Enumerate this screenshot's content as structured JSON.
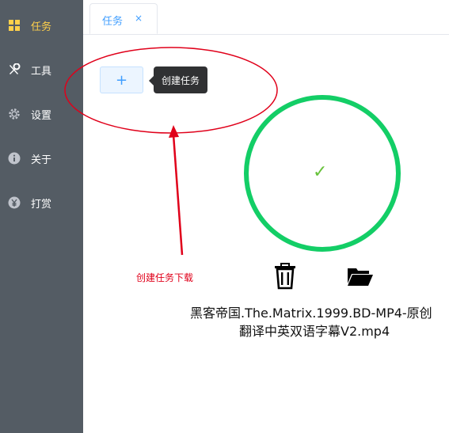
{
  "sidebar": {
    "items": [
      {
        "label": "任务",
        "icon": "grid-icon",
        "active": true
      },
      {
        "label": "工具",
        "icon": "tools-icon",
        "active": false
      },
      {
        "label": "设置",
        "icon": "gear-icon",
        "active": false
      },
      {
        "label": "关于",
        "icon": "info-icon",
        "active": false
      },
      {
        "label": "打赏",
        "icon": "yen-icon",
        "active": false
      }
    ],
    "background": "#545c64",
    "active_color": "#ffd04b"
  },
  "tabs": [
    {
      "label": "任务",
      "close": "×"
    }
  ],
  "task": {
    "add_button": "+",
    "tooltip": "创建任务",
    "annotation": "创建任务下载",
    "progress": 1.0,
    "status_icon": "check-icon",
    "file_name_line1": "黑客帝国.The.Matrix.1999.BD-MP4-原创",
    "file_name_line2": "翻译中英双语字幕V2.mp4",
    "delete_icon": "trash-icon",
    "open_folder_icon": "folder-open-icon"
  },
  "colors": {
    "accent": "#409eff",
    "success": "#13ce66",
    "annotation": "#e0001a"
  }
}
